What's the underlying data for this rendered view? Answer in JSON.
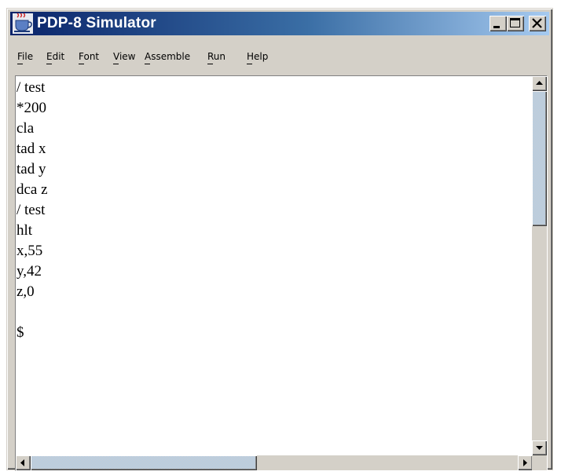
{
  "window": {
    "title": "PDP-8 Simulator",
    "title_icon": "java-coffee-cup-icon",
    "titlebar_gradient": [
      "#0a246a",
      "#a6caf0"
    ],
    "controls": [
      "minimize-icon",
      "maximize-icon",
      "close-icon"
    ]
  },
  "menu": {
    "file": "File",
    "edit": "Edit",
    "font": "Font",
    "view": "View",
    "assemble": "Assemble",
    "run": "Run",
    "help": "Help"
  },
  "editor": {
    "content": "/ test\n*200\ncla\ntad x\ntad y\ndca z\n/ test\nhlt\nx,55\ny,42\nz,0\n\n$"
  },
  "scrollbars": {
    "vertical_position": 0,
    "horizontal_position": 0,
    "thumb_color": "#a6caf0"
  }
}
